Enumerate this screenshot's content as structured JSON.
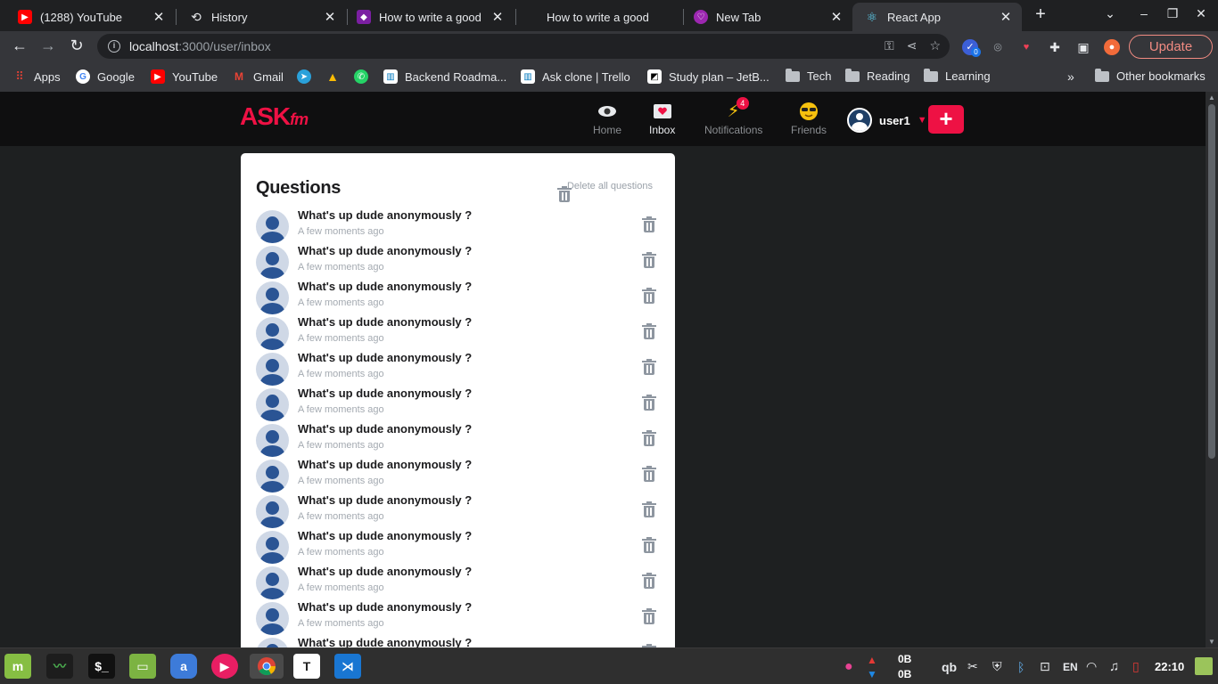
{
  "browser": {
    "tabs": [
      {
        "title": "(1288) YouTube",
        "icon": "youtube-icon",
        "color": "#ff0000"
      },
      {
        "title": "History",
        "icon": "history-icon",
        "color": "#35363a"
      },
      {
        "title": "How to write a good",
        "icon": "site-icon",
        "color": "#7b1fa2"
      },
      {
        "title": "How to write a good",
        "icon": "blank-icon",
        "color": "#1f2022"
      },
      {
        "title": "New Tab",
        "icon": "newtab-icon",
        "color": "#9c27b0"
      },
      {
        "title": "React App",
        "icon": "react-icon",
        "color": "#61dafb"
      }
    ],
    "active_tab": 5,
    "url_host": "localhost",
    "url_path": ":3000/user/inbox",
    "update_label": "Update",
    "extension_badge": "0",
    "bookmarks": [
      {
        "label": "Apps",
        "icon": "apps-icon"
      },
      {
        "label": "Google",
        "icon": "google-icon"
      },
      {
        "label": "YouTube",
        "icon": "youtube-icon"
      },
      {
        "label": "Gmail",
        "icon": "gmail-icon"
      },
      {
        "label": "",
        "icon": "telegram-icon"
      },
      {
        "label": "",
        "icon": "drive-icon"
      },
      {
        "label": "",
        "icon": "whatsapp-icon"
      },
      {
        "label": "Backend Roadma...",
        "icon": "trello-icon"
      },
      {
        "label": "Ask clone | Trello",
        "icon": "trello-icon"
      },
      {
        "label": "Study plan – JetB...",
        "icon": "jetbrains-icon"
      },
      {
        "label": "Tech",
        "icon": "folder-icon"
      },
      {
        "label": "Reading",
        "icon": "folder-icon"
      },
      {
        "label": "Learning",
        "icon": "folder-icon"
      }
    ],
    "other_bookmarks": "Other bookmarks",
    "overflow": "»"
  },
  "site": {
    "logo_main": "ASK",
    "logo_suffix": "fm",
    "nav": [
      {
        "label": "Home",
        "icon": "eye-icon"
      },
      {
        "label": "Inbox",
        "icon": "inbox-icon"
      },
      {
        "label": "Notifications",
        "icon": "lightning-icon",
        "badge": "4"
      },
      {
        "label": "Friends",
        "icon": "sunglasses-icon"
      }
    ],
    "username": "user1",
    "brand_color": "#ee1144"
  },
  "inbox": {
    "title": "Questions",
    "delete_all_label": "Delete all questions",
    "questions": [
      {
        "text": "What's up dude anonymously ?",
        "time": "A few moments ago"
      },
      {
        "text": "What's up dude anonymously ?",
        "time": "A few moments ago"
      },
      {
        "text": "What's up dude anonymously ?",
        "time": "A few moments ago"
      },
      {
        "text": "What's up dude anonymously ?",
        "time": "A few moments ago"
      },
      {
        "text": "What's up dude anonymously ?",
        "time": "A few moments ago"
      },
      {
        "text": "What's up dude anonymously ?",
        "time": "A few moments ago"
      },
      {
        "text": "What's up dude anonymously ?",
        "time": "A few moments ago"
      },
      {
        "text": "What's up dude anonymously ?",
        "time": "A few moments ago"
      },
      {
        "text": "What's up dude anonymously ?",
        "time": "A few moments ago"
      },
      {
        "text": "What's up dude anonymously ?",
        "time": "A few moments ago"
      },
      {
        "text": "What's up dude anonymously ?",
        "time": "A few moments ago"
      },
      {
        "text": "What's up dude anonymously ?",
        "time": "A few moments ago"
      },
      {
        "text": "What's up dude anonymously ?",
        "time": "A few moments ago"
      }
    ]
  },
  "taskbar": {
    "net_up": "0B",
    "net_down": "0B",
    "lang": "EN",
    "clock": "22:10"
  }
}
